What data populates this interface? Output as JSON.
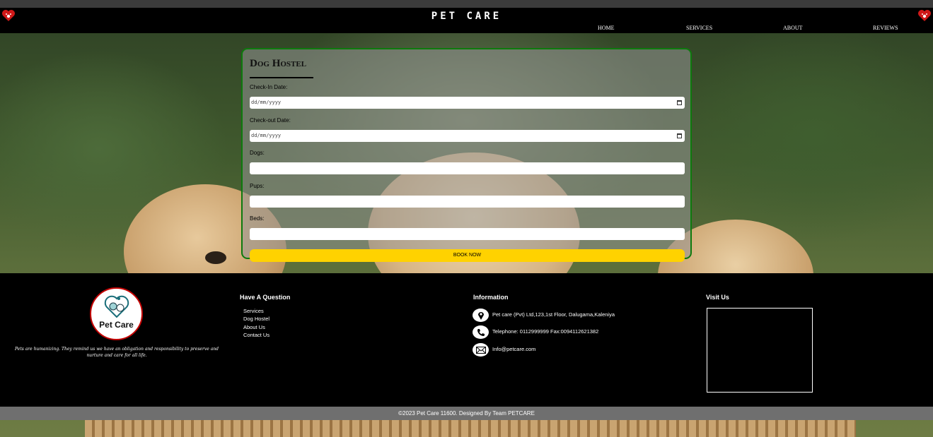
{
  "header": {
    "site_title": "PET CARE",
    "nav": [
      "HOME",
      "SERVICES",
      "ABOUT",
      "REVIEWS"
    ]
  },
  "booking": {
    "title": "Dog Hostel",
    "checkin_label": "Check-In Date:",
    "checkin_placeholder": "dd/mm/yyyy",
    "checkout_label": "Check-out Date:",
    "checkout_placeholder": "dd/mm/yyyy",
    "dogs_label": "Dogs:",
    "pups_label": "Pups:",
    "beds_label": "Beds:",
    "submit_label": "BOOK NOW"
  },
  "footer": {
    "logo_text": "Pet Care",
    "tagline": "Pets are humanizing. They remind us we have an obligation and responsibility to preserve and nurture and care for all life.",
    "question_heading": "Have A Question",
    "quick_links": [
      "Services",
      "Dog Hostel",
      "About Us",
      "Contact Us"
    ],
    "info_heading": "Information",
    "address": "Pet care (Pvt) Ltd,123,1st Floor, Dalugama,Kaleniya",
    "phone": "Telephone: 0112999999 Fax:0094112621382",
    "email": "Info@petcare.com",
    "visit_heading": "Visit Us",
    "copyright": "©2023 Pet Care 11600. Designed By Team PETCARE"
  },
  "colors": {
    "card_border": "#0d7a0d",
    "button": "#ffd200",
    "logo_heart": "#c40000"
  },
  "icons": [
    "paw-heart-icon",
    "location-icon",
    "phone-icon",
    "mail-icon",
    "calendar-icon"
  ]
}
